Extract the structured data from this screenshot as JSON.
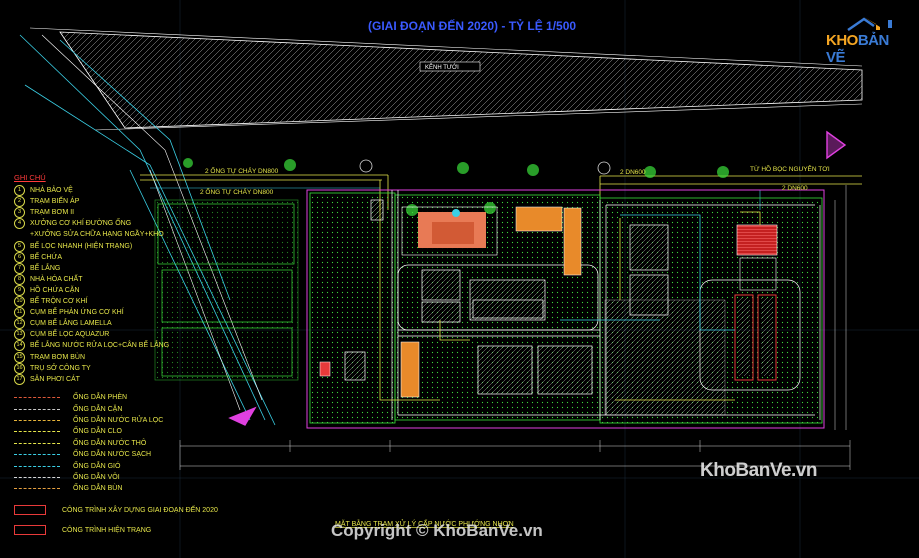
{
  "drawing": {
    "plan_title": "MẶT BẰNG TRẠM XỬ LÝ CẤP NƯỚC PHƯỚNG NHƠN",
    "top_label": "(GIAI ĐOẠN ĐẾN 2020) - TỶ LỆ 1/500",
    "canal_label": "KÊNH TƯỚI",
    "pipe_label_1": "2 ỐNG TỰ CHẢY DN800",
    "pipe_label_2": "2 ỐNG TỰ CHẢY DN800",
    "pipe_label_3": "2 DN600",
    "pipe_label_4": "TỪ HỒ BỌC NGUYÊN TƠI",
    "pipe_label_5": "2 DN600"
  },
  "legend": {
    "title": "GHI CHÚ",
    "items": [
      {
        "num": "1",
        "label": "NHÀ BẢO VỆ"
      },
      {
        "num": "2",
        "label": "TRẠM BIẾN ÁP"
      },
      {
        "num": "3",
        "label": "TRẠM BƠM II"
      },
      {
        "num": "4",
        "label": "XƯỞNG CƠ KHÍ ĐƯỜNG ỐNG"
      },
      {
        "num": "",
        "label": "+XƯỞNG SỬA CHỮA HẠNG NGẦY+KHO"
      },
      {
        "num": "5",
        "label": "BỂ LỌC NHANH (HIỆN TRẠNG)"
      },
      {
        "num": "6",
        "label": "BỂ CHỨA"
      },
      {
        "num": "7",
        "label": "BỂ LẮNG"
      },
      {
        "num": "8",
        "label": "NHÀ HÓA CHẤT"
      },
      {
        "num": "9",
        "label": "HỒ CHỨA CẶN"
      },
      {
        "num": "10",
        "label": "BỂ TRỘN CƠ KHÍ"
      },
      {
        "num": "11",
        "label": "CỤM BỂ PHẢN ỨNG CƠ KHÍ"
      },
      {
        "num": "12",
        "label": "CỤM BỂ LẮNG LAMELLA"
      },
      {
        "num": "13",
        "label": "CỤM BỂ LỌC AQUAZUR"
      },
      {
        "num": "14",
        "label": "BỂ LẮNG NƯỚC RỬA LỌC+CÂN BỂ LẮNG"
      },
      {
        "num": "15",
        "label": "TRẠM BƠM BÙN"
      },
      {
        "num": "16",
        "label": "TRỤ SỞ CÔNG TY"
      },
      {
        "num": "17",
        "label": "SÂN PHƠI CÁT"
      }
    ],
    "pipes": [
      {
        "label": "ỐNG DẪN PHÈN",
        "color": "#e05a3a"
      },
      {
        "label": "ỐNG DẪN CẶN",
        "color": "#c8c8c8"
      },
      {
        "label": "ỐNG DẪN NƯỚC RỬA LỌC",
        "color": "#e6b43a"
      },
      {
        "label": "ỐNG DẪN CLO",
        "color": "#e6e64a"
      },
      {
        "label": "ỐNG DẪN NƯỚC THÔ",
        "color": "#e6e64a"
      },
      {
        "label": "ỐNG DẪN NƯỚC SẠCH",
        "color": "#3ad0e6"
      },
      {
        "label": "ỐNG DẪN GIÓ",
        "color": "#3ad0e6"
      },
      {
        "label": "ỐNG DẪN VÔI",
        "color": "#d8d8d8"
      },
      {
        "label": "ỐNG DẪN BÙN",
        "color": "#e6a040"
      }
    ],
    "status": [
      {
        "label": "CÔNG TRÌNH XÂY DỰNG GIAI ĐOẠN ĐẾN 2020",
        "color": "#e83a3a"
      },
      {
        "label": "CÔNG TRÌNH HIỆN TRẠNG",
        "color": "#e83a3a"
      }
    ]
  },
  "logo": {
    "brand_a": "KHO",
    "brand_b": "BẢN VẼ"
  },
  "watermark": {
    "site": "KhoBanVe.vn",
    "copyright": "Copyright © KhoBanVe.vn"
  },
  "colors": {
    "background": "#000000",
    "green": "#3adf3a",
    "cyan": "#3ad0e6",
    "yellow": "#e6e64a",
    "magenta": "#e040e0",
    "red": "#e83a3a",
    "orange": "#e88a2a"
  }
}
